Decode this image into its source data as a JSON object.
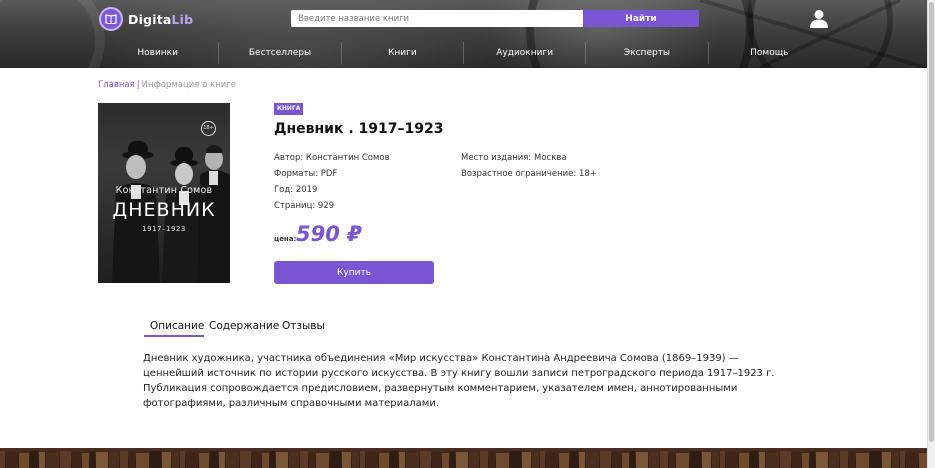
{
  "header": {
    "logo": {
      "part1": "Digita",
      "part2": "Lib"
    },
    "search": {
      "placeholder": "Введите название книги",
      "button_label": "Найти"
    },
    "nav": [
      "Новинки",
      "Бестселлеры",
      "Книги",
      "Аудиокниги",
      "Эксперты",
      "Помощь"
    ]
  },
  "breadcrumb": {
    "home": "Главная",
    "separator": "|",
    "current": "Информация о книге"
  },
  "book": {
    "badge": "КНИГА",
    "title": "Дневник . 1917–1923",
    "cover": {
      "author": "Константин Сомов",
      "title": "ДНЕВНИК",
      "years": "1917–1923",
      "age": "18+"
    },
    "details_left": [
      "Автор: Константин Сомов",
      "Форматы: PDF",
      "Год: 2019",
      "Страниц: 929"
    ],
    "details_right": [
      "Место издания: Москва",
      "Возрастное ограничение: 18+"
    ],
    "price_label": "цена:",
    "price": "590 ₽",
    "buy_label": "Купить"
  },
  "tabs": [
    "Описание",
    "Содержание",
    "Отзывы"
  ],
  "description": "Дневник художника, участника объединения «Мир искусства» Константина Андреевича Сомова (1869–1939) — ценнейший источник по истории русского искусства. В эту книгу вошли записи петроградского периода 1917–1923 г. Публикация сопровождается предисловием, развернутым комментарием, указателем имен, аннотированными фотографиями, различным справочными материалами.",
  "colors": {
    "accent": "#7a55d4",
    "header_bg": "#3c3c3c",
    "footer_bg": "#3a2418"
  }
}
